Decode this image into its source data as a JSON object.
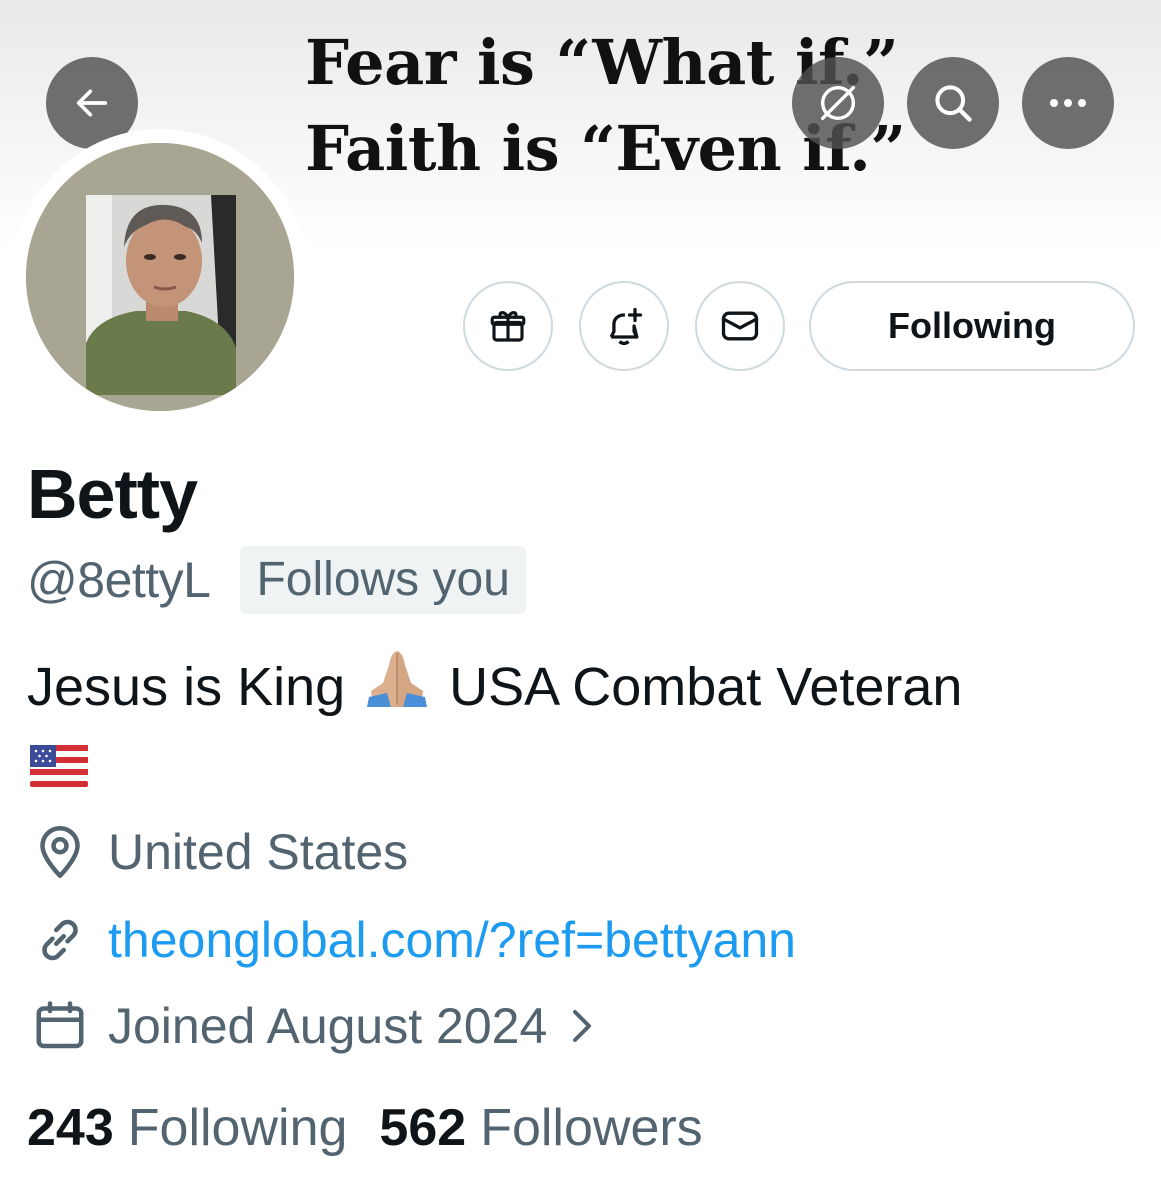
{
  "banner": {
    "quote_line1": "Fear is “What if.”",
    "quote_line2": "Faith is “Even if.”"
  },
  "topbar": {
    "back_icon": "arrow-left-icon",
    "translate_icon": "translate-icon",
    "search_icon": "search-icon",
    "more_icon": "more-dots-icon"
  },
  "actions": {
    "gift_icon": "gift-icon",
    "notify_icon": "bell-plus-icon",
    "message_icon": "envelope-icon",
    "following_label": "Following"
  },
  "profile": {
    "display_name": "Betty",
    "handle": "@8ettyL",
    "follows_you": "Follows you",
    "bio_part1": "Jesus is King",
    "bio_emoji1": "folded-hands-emoji",
    "bio_part2": "USA Combat Veteran",
    "bio_emoji2": "us-flag-emoji",
    "location": "United States",
    "link": "theonglobal.com/?ref=bettyann",
    "joined": "Joined August 2024"
  },
  "stats": {
    "following_count": "243",
    "following_label": "Following",
    "followers_count": "562",
    "followers_label": "Followers"
  },
  "colors": {
    "text_primary": "#0f1419",
    "text_secondary": "#536471",
    "link": "#1d9bf0",
    "border": "#cfd9de",
    "badge_bg": "#eff3f4"
  }
}
